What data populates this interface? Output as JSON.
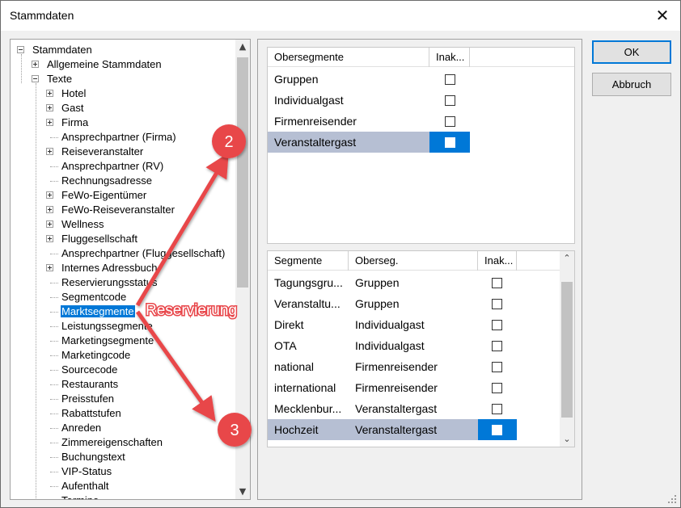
{
  "window": {
    "title": "Stammdaten",
    "close_glyph": "✕"
  },
  "tree": {
    "items": [
      {
        "label": "Stammdaten",
        "level": 0,
        "expander": "minus"
      },
      {
        "label": "Allgemeine Stammdaten",
        "level": 1,
        "expander": "plus"
      },
      {
        "label": "Texte",
        "level": 1,
        "expander": "minus"
      },
      {
        "label": "Hotel",
        "level": 2,
        "expander": "plus"
      },
      {
        "label": "Gast",
        "level": 2,
        "expander": "plus"
      },
      {
        "label": "Firma",
        "level": 2,
        "expander": "plus"
      },
      {
        "label": "Ansprechpartner (Firma)",
        "level": 2,
        "expander": "none"
      },
      {
        "label": "Reiseveranstalter",
        "level": 2,
        "expander": "plus"
      },
      {
        "label": "Ansprechpartner (RV)",
        "level": 2,
        "expander": "none"
      },
      {
        "label": "Rechnungsadresse",
        "level": 2,
        "expander": "none"
      },
      {
        "label": "FeWo-Eigentümer",
        "level": 2,
        "expander": "plus"
      },
      {
        "label": "FeWo-Reiseveranstalter",
        "level": 2,
        "expander": "plus"
      },
      {
        "label": "Wellness",
        "level": 2,
        "expander": "plus"
      },
      {
        "label": "Fluggesellschaft",
        "level": 2,
        "expander": "plus"
      },
      {
        "label": "Ansprechpartner (Fluggesellschaft)",
        "level": 2,
        "expander": "none"
      },
      {
        "label": "Internes Adressbuch",
        "level": 2,
        "expander": "plus"
      },
      {
        "label": "Reservierungsstatus",
        "level": 2,
        "expander": "none"
      },
      {
        "label": "Segmentcode",
        "level": 2,
        "expander": "none"
      },
      {
        "label": "Marktsegmente",
        "level": 2,
        "expander": "none",
        "selected": true
      },
      {
        "label": "Leistungssegmente",
        "level": 2,
        "expander": "none"
      },
      {
        "label": "Marketingsegmente",
        "level": 2,
        "expander": "none"
      },
      {
        "label": "Marketingcode",
        "level": 2,
        "expander": "none"
      },
      {
        "label": "Sourcecode",
        "level": 2,
        "expander": "none"
      },
      {
        "label": "Restaurants",
        "level": 2,
        "expander": "none"
      },
      {
        "label": "Preisstufen",
        "level": 2,
        "expander": "none"
      },
      {
        "label": "Rabattstufen",
        "level": 2,
        "expander": "none"
      },
      {
        "label": "Anreden",
        "level": 2,
        "expander": "none"
      },
      {
        "label": "Zimmereigenschaften",
        "level": 2,
        "expander": "none"
      },
      {
        "label": "Buchungstext",
        "level": 2,
        "expander": "none"
      },
      {
        "label": "VIP-Status",
        "level": 2,
        "expander": "none"
      },
      {
        "label": "Aufenthalt",
        "level": 2,
        "expander": "none"
      },
      {
        "label": "Termine",
        "level": 2,
        "expander": "none"
      }
    ]
  },
  "obersegmente": {
    "headers": [
      "Obersegmente",
      "Inak..."
    ],
    "rows": [
      {
        "name": "Gruppen",
        "inaktiv": false
      },
      {
        "name": "Individualgast",
        "inaktiv": false
      },
      {
        "name": "Firmenreisender",
        "inaktiv": false
      },
      {
        "name": "Veranstaltergast",
        "inaktiv": false,
        "selected": true
      }
    ]
  },
  "segmente": {
    "headers": [
      "Segmente",
      "Oberseg.",
      "Inak..."
    ],
    "rows": [
      {
        "name": "Tagungsgru...",
        "oberseg": "Gruppen",
        "inaktiv": false
      },
      {
        "name": "Veranstaltu...",
        "oberseg": "Gruppen",
        "inaktiv": false
      },
      {
        "name": "Direkt",
        "oberseg": "Individualgast",
        "inaktiv": false
      },
      {
        "name": "OTA",
        "oberseg": "Individualgast",
        "inaktiv": false
      },
      {
        "name": "national",
        "oberseg": "Firmenreisender",
        "inaktiv": false
      },
      {
        "name": "international",
        "oberseg": "Firmenreisender",
        "inaktiv": false
      },
      {
        "name": "Mecklenbur...",
        "oberseg": "Veranstaltergast",
        "inaktiv": false
      },
      {
        "name": "Hochzeit",
        "oberseg": "Veranstaltergast",
        "inaktiv": false,
        "selected": true
      }
    ]
  },
  "buttons": {
    "ok": "OK",
    "cancel": "Abbruch"
  },
  "annotations": {
    "color": "#e8464a",
    "badge_2": "2",
    "badge_3": "3",
    "label": "Reservierung"
  }
}
